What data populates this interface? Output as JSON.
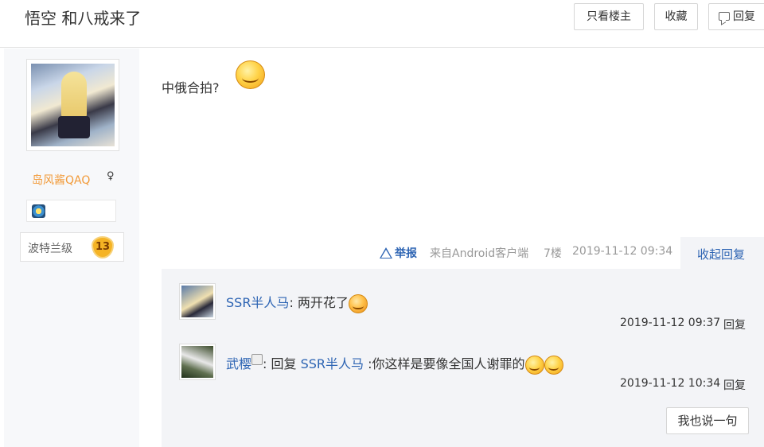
{
  "thread": {
    "title": "悟空 和八戒来了",
    "buttons": {
      "only_op": "只看楼主",
      "favorite": "收藏",
      "reply": "回复"
    }
  },
  "author": {
    "name": "岛风酱QAQ",
    "gender_icon": "♀",
    "level_title": "波特兰级",
    "level": "13"
  },
  "post": {
    "text": "中俄合拍?",
    "emoji": "smiley-icon",
    "report": "举报",
    "source": "来自Android客户端",
    "floor": "7楼",
    "time": "2019-11-12 09:34",
    "collapse": "收起回复"
  },
  "replies": [
    {
      "user": "SSR半人马",
      "separator": ": ",
      "text": "两开花了",
      "time": "2019-11-12 09:37",
      "reply": "回复"
    },
    {
      "user": "武樱",
      "separator": ": 回复 ",
      "target": "SSR半人马",
      "text": " :你这样是要像全国人谢罪的",
      "time": "2019-11-12 10:34",
      "reply": "回复"
    }
  ],
  "say_button": "我也说一句",
  "colors": {
    "link": "#2d64b3",
    "username": "#f29a38",
    "reply_bg": "#f3f4f7",
    "sidebar_bg": "#f7f8fa"
  }
}
